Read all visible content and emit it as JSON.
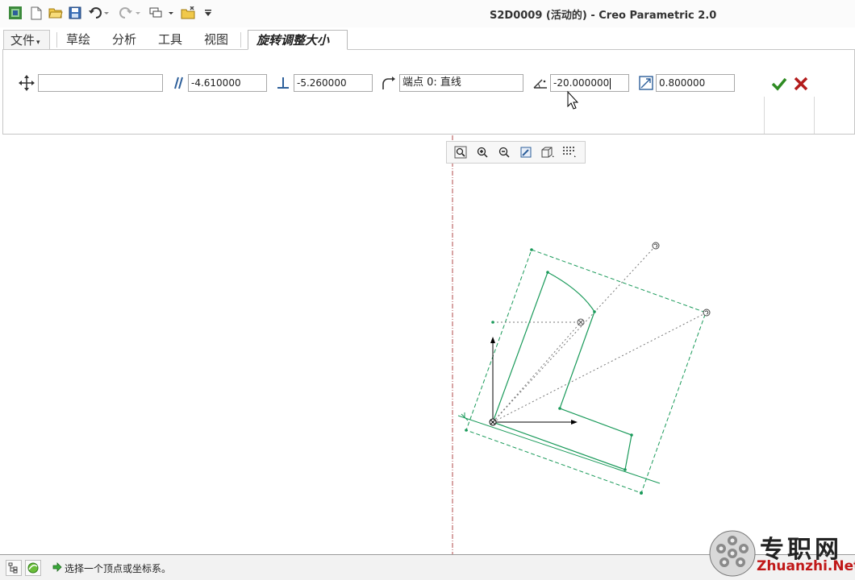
{
  "window": {
    "title": "S2D0009 (活动的) - Creo Parametric 2.0"
  },
  "quick_access": {
    "icons": [
      "app-logo-icon",
      "new-file-icon",
      "open-folder-icon",
      "save-icon",
      "undo-icon",
      "redo-icon",
      "windows-icon",
      "close-window-icon",
      "customize-icon"
    ]
  },
  "menu": {
    "file": "文件",
    "tabs": [
      "草绘",
      "分析",
      "工具",
      "视图"
    ],
    "active_tab": "旋转调整大小"
  },
  "dashboard": {
    "translate_value": "",
    "horizontal_value": "-4.610000",
    "vertical_value": "-5.260000",
    "reference": "端点 0: 直线",
    "rotation_value": "-20.000000",
    "scale_value": "0.800000",
    "colors": {
      "ok": "#2e8b22",
      "cancel": "#b31b1b"
    }
  },
  "view_toolbar": {
    "icons": [
      "refit-icon",
      "zoom-in-icon",
      "zoom-out-icon",
      "repaint-icon",
      "display-style-icon",
      "sketcher-display-icon"
    ]
  },
  "status": {
    "message": "选择一个顶点或坐标系。"
  },
  "watermark": {
    "cn": "专职网",
    "en": "Zhuanzhi.Net"
  },
  "colors": {
    "sketch": "#1a9a5a",
    "reference": "#7a7a7a",
    "center_line": "#b04848"
  }
}
